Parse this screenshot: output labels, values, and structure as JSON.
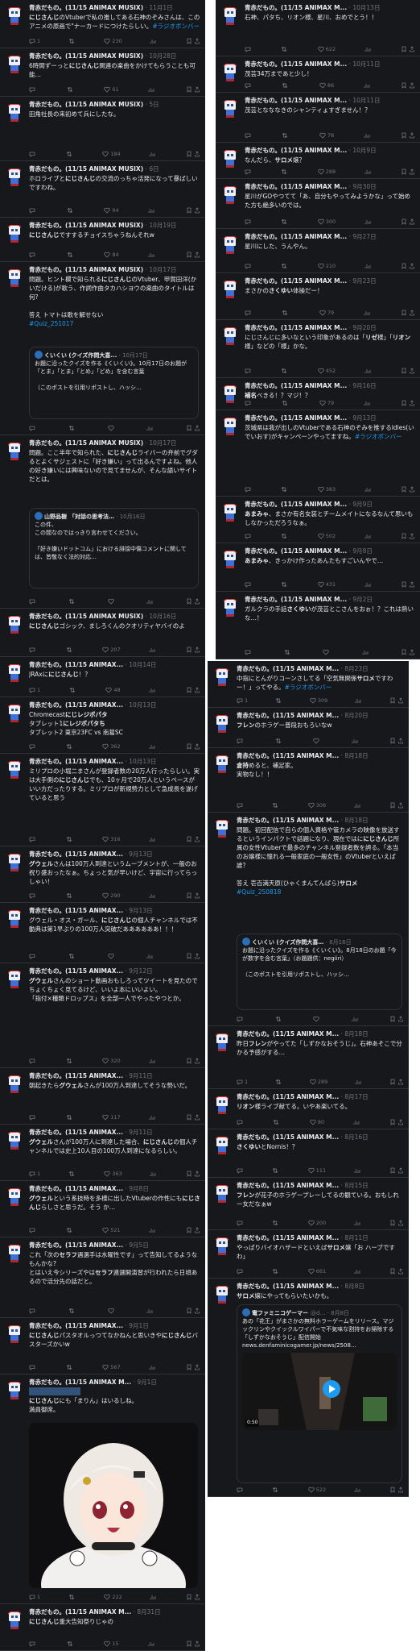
{
  "colors": {
    "panel": "#16181c",
    "text": "#e7e9ea",
    "muted": "#71767b",
    "link": "#1d9bf0",
    "border": "#2f3336"
  },
  "icons": [
    "reply-icon",
    "retweet-icon",
    "like-icon",
    "views-icon",
    "bookmark-icon",
    "share-icon",
    "play-icon"
  ],
  "p1": [
    {
      "name": "青赤だもの。(11/15 ANIMAX MUSIX)",
      "date": "11月1日",
      "text": [
        {
          "t": "にじさんじ",
          "h": 1
        },
        {
          "t": "のVtuberで私の推してある石神のぞみさんは、このアニメの原画で\"ナーカードにつけたらしい。"
        },
        {
          "t": "#ラジオボンバー",
          "l": 1
        }
      ],
      "stats": [
        "1",
        "",
        "230",
        ""
      ]
    },
    {
      "name": "青赤だもの。(11/15 ANIMAX MUSIX)",
      "date": "10月28日",
      "text": [
        {
          "t": "6時間ずーっと"
        },
        {
          "t": "にじさんじ",
          "h": 1
        },
        {
          "t": "関連の楽曲をかけてもらうことも可能…"
        }
      ],
      "stats": [
        "",
        "",
        "61",
        ""
      ]
    },
    {
      "name": "青赤だもの。(11/15 ANIMAX MUSIX)",
      "date": "5日",
      "text": [
        {
          "t": "田角社長の来初めて兵にしたな。"
        }
      ],
      "stats": [
        "",
        "",
        "184",
        ""
      ]
    },
    {
      "name": "青赤だもの。(11/15 ANIMAX MUSIX)",
      "date": "6日",
      "text": [
        {
          "t": "ホロライブと"
        },
        {
          "t": "にじさんじ",
          "h": 1
        },
        {
          "t": "の交流のっちゃ活発になって暴ばしいですわね。"
        }
      ],
      "stats": [
        "",
        "",
        "94",
        ""
      ]
    },
    {
      "name": "青赤だもの。(11/15 ANIMAX MUSIX)",
      "date": "10月19日",
      "text": [
        {
          "t": "にじさんじ",
          "h": 1
        },
        {
          "t": "ですするチョイスちゃうねんそれw"
        }
      ],
      "stats": [
        "",
        "",
        "84",
        ""
      ]
    },
    {
      "name": "青赤だもの。(11/15 ANIMAX MUSIX)",
      "date": "10月17日",
      "text": [
        {
          "t": "問題。ヒント欄で知られる"
        },
        {
          "t": "にじさんじ",
          "h": 1
        },
        {
          "t": "のVtuber、甲賀田洋(かいだける)が歌う、作詞作曲タカハシヨウの楽曲のタイトルは何?\n\n答え トマトは歌を解せない\n"
        },
        {
          "t": "#Quiz_251017",
          "l": 1
        }
      ],
      "stats": [
        "",
        "",
        "",
        ""
      ]
    },
    {
      "name": "青赤だもの。(11/15 ANIMAX MUSIX)",
      "date": "10月17日",
      "text": [
        {
          "t": "問題。ここ半年で知られた、"
        },
        {
          "t": "にじさんじ",
          "h": 1
        },
        {
          "t": "ライバーの弁前でグダるとよくサジェストに「好き嫌い」って出るんですよね。他人の好き嫌いには興味ないので見てませんが、そんな語いサイトだとは。"
        }
      ],
      "stats": [
        "",
        "",
        "",
        ""
      ]
    },
    {
      "name": "青赤だもの。(11/15 ANIMAX MUSIX)",
      "date": "10月16日",
      "text": [
        {
          "t": "にじさんじ",
          "h": 1
        },
        {
          "t": "ゴシック、ましろくんのクオリティヤバイのよ"
        }
      ],
      "stats": [
        "",
        "",
        "207",
        ""
      ]
    },
    {
      "name": "青赤だもの。(11/15 ANIMAX...",
      "date": "10月14日",
      "text": [
        {
          "t": "JRAxに"
        },
        {
          "t": "にじさんじ",
          "h": 1
        },
        {
          "t": "！？"
        }
      ],
      "stats": [
        "1",
        "",
        "48",
        ""
      ]
    },
    {
      "name": "青赤だもの。(11/15 ANIMAX...",
      "date": "10月13日",
      "text": [
        {
          "t": "Chromecast"
        },
        {
          "t": "にじレジポパタ",
          "h": 1
        },
        {
          "t": "\nタブレット1"
        },
        {
          "t": "にレジポパタち",
          "h": 1
        },
        {
          "t": "\nタブレット2 東京23FC vs 南葛SC"
        }
      ],
      "stats": [
        "",
        "",
        "362",
        ""
      ]
    },
    {
      "name": "青赤だもの。(11/15 ANIMAX...",
      "date": "10月13日",
      "text": [
        {
          "t": "ミリプロの小堀二まさんが登録者数の20万人行ったらしい。実は大手側の"
        },
        {
          "t": "にじさんじ",
          "h": 1
        },
        {
          "t": "でも、10ヶ月で20万人というペースがいい方だったりする。ミリプロが新規勢力として急成長を遂げていると思う"
        }
      ],
      "stats": [
        "",
        "",
        "316",
        ""
      ]
    },
    {
      "name": "青赤だもの。(11/15 ANIMAX...",
      "date": "9月13日",
      "text": [
        {
          "t": "グウェル",
          "h": 1
        },
        {
          "t": "さんは100万人到達というムーブメントが、一般のお祝り盛おったなぁ。ちょっと気が早いけど、宇宙に行ってらっしゃい！"
        }
      ],
      "stats": [
        "",
        "",
        "290",
        ""
      ]
    },
    {
      "name": "青赤だもの。(11/15 ANIMAX...",
      "date": "9月13日",
      "text": [
        {
          "t": "グウェル・オス・ガール、"
        },
        {
          "t": "にじさんじ",
          "h": 1
        },
        {
          "t": "の個人チャンネルでは不動典は第1早ぶりの100万人突破だああああああ！！！"
        }
      ],
      "stats": [
        "",
        "",
        "",
        ""
      ]
    },
    {
      "name": "青赤だもの。(11/15 ANIMAX...",
      "date": "9月12日",
      "text": [
        {
          "t": "グウェル",
          "h": 1
        },
        {
          "t": "さんのショート動画おもしろってツイートを見たのでちょくちょく見てるけど、いいよ本にいいよい。\n「指付×種類ドロップス」を全部一人でやったやつとか。"
        }
      ],
      "stats": [
        "",
        "",
        "320",
        ""
      ]
    },
    {
      "name": "青赤だもの。(11/15 ANIMAX...",
      "date": "9月11日",
      "text": [
        {
          "t": "朝起きたら"
        },
        {
          "t": "グウェル",
          "h": 1
        },
        {
          "t": "さんが100万人到達してそうな勢いだ。"
        }
      ],
      "stats": [
        "",
        "",
        "117",
        ""
      ]
    },
    {
      "name": "青赤だもの。(11/15 ANIMAX...",
      "date": "9月11日",
      "text": [
        {
          "t": "グウェル",
          "h": 1
        },
        {
          "t": "さんが100万人に到達した場合、"
        },
        {
          "t": "にじさんじ",
          "h": 1
        },
        {
          "t": "の個人チャンネルでは史上10人目の100万人到達になるらしい。"
        }
      ],
      "stats": [
        "1",
        "",
        "363",
        ""
      ]
    },
    {
      "name": "青赤だもの。(11/15 ANIMAX...",
      "date": "9月8日",
      "text": [
        {
          "t": "グウェル",
          "h": 1
        },
        {
          "t": "という系技時を多様に出したVtuberの作性にも"
        },
        {
          "t": "にじさんじ",
          "h": 1
        },
        {
          "t": "らしさと思うだ。そう か…"
        }
      ],
      "stats": [
        "",
        "",
        "521",
        ""
      ]
    },
    {
      "name": "青赤だもの。(11/15 ANIMAX...",
      "date": "9月5日",
      "text": [
        {
          "t": "これ「次の"
        },
        {
          "t": "セラフ",
          "h": 1
        },
        {
          "t": "遇選手は水曜性です」って告知してるようなもんかな?\nとはいえ今シリーズやは"
        },
        {
          "t": "セラフ",
          "h": 1
        },
        {
          "t": "連選開演習が行われたら日頃あるので活分先の話だと。"
        }
      ],
      "stats": [
        "",
        "",
        "",
        ""
      ]
    },
    {
      "name": "青赤だもの。(11/15 ANIMAX...",
      "date": "9月1日",
      "text": [
        {
          "t": "にじさんじ",
          "h": 1
        },
        {
          "t": "パスタオルっつてなかねんと思いきや"
        },
        {
          "t": "にじさんじ",
          "h": 1
        },
        {
          "t": "バスターズかいw"
        }
      ],
      "stats": [
        "",
        "",
        "567",
        ""
      ]
    },
    {
      "name": "青赤だもの。(11/15 ANIMAX M...",
      "date": "9月1日",
      "text": [
        {
          "t": "\n"
        },
        {
          "t": "にじさんじ",
          "h": 1
        },
        {
          "t": "にも「まりん」はいるしね。\n満員御席。"
        }
      ],
      "stats": [
        "1",
        "",
        "222",
        ""
      ]
    },
    {
      "name": "青赤だもの。(11/15 ANIMAX M...",
      "date": "8月31日",
      "text": [
        {
          "t": "にじさんじ",
          "h": 1
        },
        {
          "t": "重大告知祭りじゃの"
        }
      ],
      "stats": [
        "",
        "",
        "15",
        ""
      ]
    }
  ],
  "q1": {
    "name": "くいくい (クイズ作問大喜...",
    "date": "10月17日",
    "text": "お題に沿ったクイズを作る《くいくい》。10月17日のお題が「とま」「とま」「とめ」「どめ」を含む言葉\n\n（このポストを引用リポストし、ハッシ…"
  },
  "q2": {
    "name": "山野品樹",
    "title": "「対話の思考法…",
    "date": "10月16日",
    "text": "この件、\nこの間なのではっきり言わせてください。\n\n「好き嫌いドットコム」における誹謗中傷コメントに関しては、皆敬なく法的対応…"
  },
  "p2": [
    {
      "name": "青赤だもの。(11/15 ANIMAX M...",
      "date": "10月13日",
      "text": [
        {
          "t": "石神、パタち、リオン様、星川、おめでとう！！"
        }
      ],
      "stats": [
        "",
        "",
        "622",
        ""
      ]
    },
    {
      "name": "青赤だもの。(11/15 ANIMAX M...",
      "date": "10月11日",
      "text": [
        {
          "t": "茂芸34万まであと少し！"
        }
      ],
      "stats": [
        "",
        "",
        "86",
        ""
      ]
    },
    {
      "name": "青赤だもの。(11/15 ANIMAX M...",
      "date": "10月11日",
      "text": [
        {
          "t": "茂芸となななきのシャンティょすぎません！？"
        }
      ],
      "stats": [
        "",
        "",
        "78",
        ""
      ]
    },
    {
      "name": "青赤だもの。(11/15 ANIMAX M...",
      "date": "10月9日",
      "text": [
        {
          "t": "なんだら、"
        },
        {
          "t": "サロメ",
          "h": 1
        },
        {
          "t": "嬢？"
        }
      ],
      "stats": [
        "",
        "",
        "288",
        ""
      ]
    },
    {
      "name": "青赤だもの。(11/15 ANIMAX M...",
      "date": "9月30日",
      "text": [
        {
          "t": "星川がGOやつてて「あ、自分もやってみようかな」って始めた方も絶多いのでは。"
        }
      ],
      "stats": [
        "",
        "",
        "300",
        ""
      ]
    },
    {
      "name": "青赤だもの。(11/15 ANIMAX M...",
      "date": "9月27日",
      "text": [
        {
          "t": "星川にした、うんやん。"
        }
      ],
      "stats": [
        "",
        "",
        "210",
        ""
      ]
    },
    {
      "name": "青赤だもの。(11/15 ANIMAX M...",
      "date": "9月23日",
      "text": [
        {
          "t": "まさかの"
        },
        {
          "t": "さくゆい",
          "h": 1
        },
        {
          "t": "体操だー！"
        }
      ],
      "stats": [
        "",
        "",
        "79",
        ""
      ]
    },
    {
      "name": "青赤だもの。(11/15 ANIMAX M...",
      "date": "9月20日",
      "text": [
        {
          "t": "にじさんじに多いなという印象があるのは「"
        },
        {
          "t": "リゼ",
          "h": 1
        },
        {
          "t": "様」「"
        },
        {
          "t": "リオン",
          "h": 1
        },
        {
          "t": "様」などの「様」かな。"
        }
      ],
      "stats": [
        "",
        "",
        "452",
        ""
      ]
    },
    {
      "name": "青赤だもの。(11/15 ANIMAX M...",
      "date": "9月16日",
      "text": [
        {
          "t": "補名",
          "h": 1
        },
        {
          "t": "べきる！？マジ！？"
        }
      ],
      "stats": [
        "",
        "",
        "79",
        ""
      ]
    },
    {
      "name": "青赤だもの。(11/15 ANIMAX M...",
      "date": "9月13日",
      "text": [
        {
          "t": "茨城県は我が出しのVtuberである石神のぞみを推するIdles(いでいおす)がキャンペーンやってますね。"
        },
        {
          "t": "#ラジオボンバー",
          "l": 1
        }
      ],
      "stats": [
        "",
        "",
        "383",
        ""
      ]
    },
    {
      "name": "青赤だもの。(11/15 ANIMAX M...",
      "date": "9月9日",
      "text": [
        {
          "t": "あまみゃ",
          "h": 1
        },
        {
          "t": "、まさか有名女装とチームメイトになるなんて思いもしなかっただろうなぁ。"
        }
      ],
      "stats": [
        "",
        "",
        "502",
        ""
      ]
    },
    {
      "name": "青赤だもの。(11/15 ANIMAX M...",
      "date": "9月8日",
      "text": [
        {
          "t": "あまみゃ",
          "h": 1
        },
        {
          "t": "、きっかけ作ったあんたもすごいんやで…"
        }
      ],
      "stats": [
        "",
        "",
        "431",
        ""
      ]
    },
    {
      "name": "青赤だもの。(11/15 ANIMAX M...",
      "date": "9月2日",
      "text": [
        {
          "t": "ガルクラの手話"
        },
        {
          "t": "さくゆい",
          "h": 1
        },
        {
          "t": "が茂芸とこさんをおぉ！？これは熱いな…！"
        }
      ],
      "stats": [
        "",
        "",
        "",
        ""
      ]
    }
  ],
  "p3": [
    {
      "name": "青赤だもの。(11/15 ANIMAX M...",
      "date": "8月23日",
      "text": [
        {
          "t": "中指にとんがりコーンさしてる「空気無関係"
        },
        {
          "t": "サロメ",
          "h": 1
        },
        {
          "t": "ですわー！」ってやる。"
        },
        {
          "t": "#ラジオボンバー",
          "l": 1
        }
      ],
      "stats": [
        "1",
        "",
        "309",
        ""
      ]
    },
    {
      "name": "青赤だもの。(11/15 ANIMAX M...",
      "date": "8月20日",
      "text": [
        {
          "t": "フレン",
          "h": 1
        },
        {
          "t": "のホラゲー普段おもろいなw"
        }
      ],
      "stats": [
        "",
        "",
        "",
        ""
      ]
    },
    {
      "name": "青赤だもの。(11/15 ANIMAX M...",
      "date": "8月18日",
      "text": [
        {
          "t": "倉持",
          "h": 1
        },
        {
          "t": "めると、補足家。\n実物なし！！"
        }
      ],
      "stats": [
        "",
        "",
        "306",
        ""
      ]
    },
    {
      "name": "青赤だもの。(11/15 ANIMAX M...",
      "date": "8月18日",
      "text": [
        {
          "t": "問題。初回配信で自らの個人資格や管カメラの映像を放送するというインパクトで話題になり、現在ではに"
        },
        {
          "t": "にじさんじ",
          "h": 1
        },
        {
          "t": "所属の女性Vtuberで最多のチャンネル登録者数を誇る。「本当のお嬢様に憧れる一般家庭の一般女性」のVtuberといえば誰？\n\n答え 壱百満天原(ひゃくまんてんばら)"
        },
        {
          "t": "サロメ",
          "h": 1
        },
        {
          "t": "\n"
        },
        {
          "t": "#Quiz_250818",
          "l": 1
        }
      ],
      "stats": [
        "",
        "",
        "",
        ""
      ]
    },
    {
      "name": "青赤だもの。(11/15 ANIMAX M...",
      "date": "8月18日",
      "text": [
        {
          "t": "昨日"
        },
        {
          "t": "フレン",
          "h": 1
        },
        {
          "t": "がやってた「しずかなおそうじ」。石神あそこで分かる予感がする…"
        }
      ],
      "stats": [
        "1",
        "",
        "289",
        ""
      ]
    },
    {
      "name": "青赤だもの。(11/15 ANIMAX M...",
      "date": "8月17日",
      "text": [
        {
          "t": "リオン",
          "h": 1
        },
        {
          "t": "様ライブ献てる。いやあ楽いてる。"
        }
      ],
      "stats": [
        "",
        "",
        "80",
        ""
      ]
    },
    {
      "name": "青赤だもの。(11/15 ANIMAX M...",
      "date": "8月16日",
      "text": [
        {
          "t": "さくゆい",
          "h": 1
        },
        {
          "t": "とNornis！？"
        }
      ],
      "stats": [
        "",
        "",
        "111",
        ""
      ]
    },
    {
      "name": "青赤だもの。(11/15 ANIMAX M...",
      "date": "8月15日",
      "text": [
        {
          "t": "フレン",
          "h": 1
        },
        {
          "t": "が花子のホラゲープレーしてるの観ている。おもしれー女だなぁw"
        }
      ],
      "stats": [
        "",
        "",
        "200",
        ""
      ]
    },
    {
      "name": "青赤だもの。(11/15 ANIMAX M...",
      "date": "8月11日",
      "text": [
        {
          "t": "やっぱりバイオハザードといえば"
        },
        {
          "t": "サロメ",
          "h": 1
        },
        {
          "t": "嬢「お ハーブですわ」"
        }
      ],
      "stats": [
        "",
        "",
        "661",
        ""
      ]
    },
    {
      "name": "青赤だもの。(11/15 ANIMAX M...",
      "date": "8月8日",
      "text": [
        {
          "t": "サロメ",
          "h": 1
        },
        {
          "t": "嬢にやってもらいたいかも。"
        }
      ],
      "stats": [
        "",
        "",
        "522",
        ""
      ]
    }
  ],
  "q3": {
    "name": "くいくい (クイズ作問大喜…",
    "date": "8月18日",
    "text": "お題に沿ったクイズを作る《くいくい》。8月18日のお題「今が数字を含む言葉」（お題題供：negiiri）\n\n（このポストを引用リポストし、ハッシ…"
  },
  "q4": {
    "name": "電ファミニコゲーマー",
    "handle": "@d…",
    "date": "8月8日",
    "text": "あの「花王」がまさかの無料ホラーゲームをリリース。マジックリンやクイックルワイパーで不気味な割持をお掃除する「しずかなおそうじ」配信開始\nnews.denfaminicogamer.jp/news/2508…",
    "time": "0:50"
  }
}
